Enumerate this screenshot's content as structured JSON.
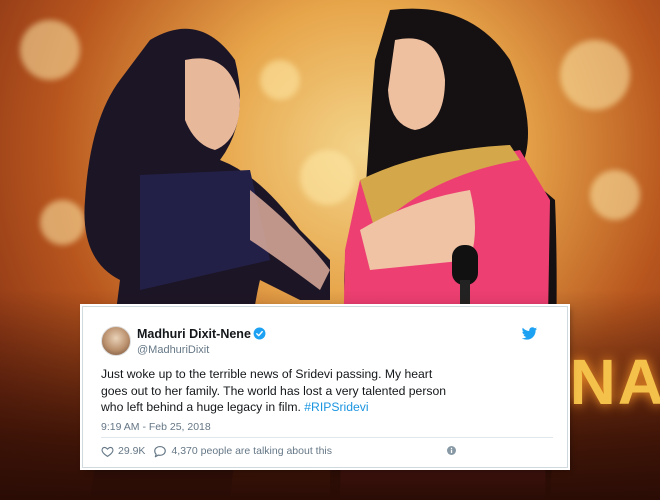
{
  "tweet": {
    "display_name": "Madhuri Dixit-Nene",
    "handle": "@MadhuriDixit",
    "text_line1": "Just woke up to the terrible news of Sridevi passing. My heart",
    "text_line2": "goes out to her family. The world has lost a very talented person",
    "text_line3": "who left behind a huge legacy in film. ",
    "hashtag": "#RIPSridevi",
    "timestamp": "9:19 AM - Feb 25, 2018",
    "likes": "29.9K",
    "talking": "4,370 people are talking about this"
  },
  "photo": {
    "stage_text": "NA"
  },
  "colors": {
    "verified": "#1da1f2",
    "hashtag": "#1b95e0",
    "twitter_bird": "#1da1f2"
  },
  "icons": [
    "verified-badge-icon",
    "twitter-bird-icon",
    "heart-icon",
    "reply-bubble-icon",
    "info-icon"
  ]
}
